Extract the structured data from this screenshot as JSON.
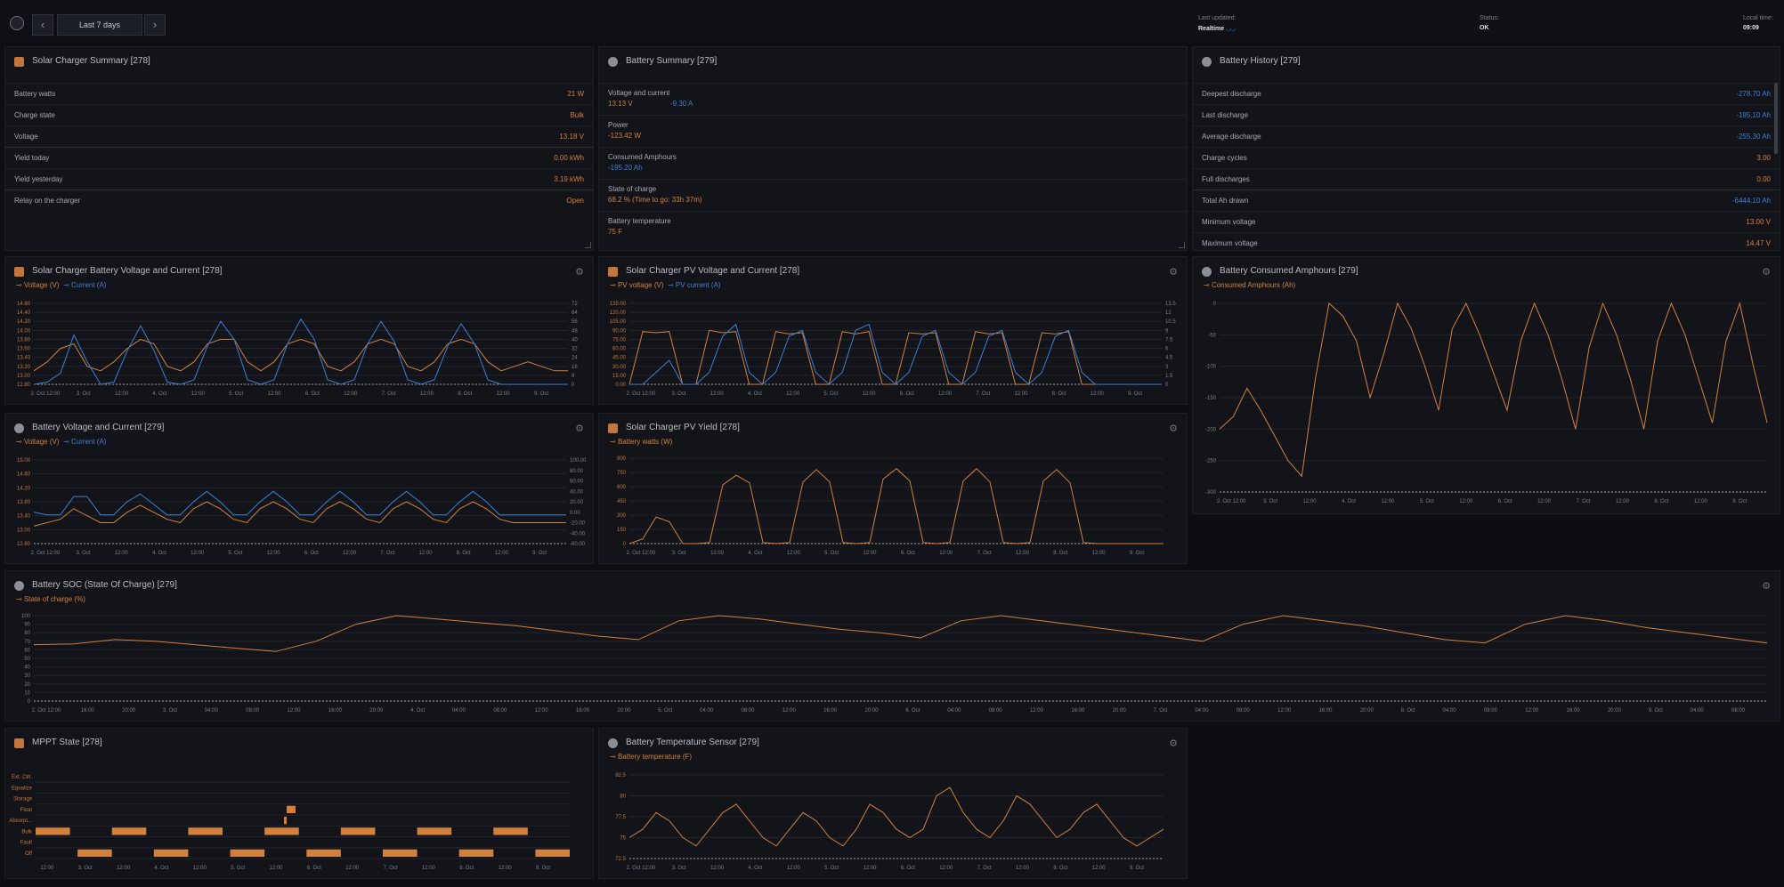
{
  "topbar": {
    "range": "Last 7 days",
    "prev_icon": "chevron-left-icon",
    "next_icon": "chevron-right-icon",
    "last_updated_label": "Last updated:",
    "last_updated_value": "Realtime",
    "status_label": "Status:",
    "status_value": "OK",
    "local_time_label": "Local time:",
    "local_time_value": "09:09"
  },
  "solar_summary": {
    "title": "Solar Charger Summary [278]",
    "rows": [
      {
        "label": "Battery watts",
        "value": "21 W"
      },
      {
        "label": "Charge state",
        "value": "Bulk"
      },
      {
        "label": "Voltage",
        "value": "13.18 V"
      },
      {
        "label": "Yield today",
        "value": "0.00 kWh"
      },
      {
        "label": "Yield yesterday",
        "value": "3.19 kWh"
      },
      {
        "label": "Relay on the charger",
        "value": "Open"
      }
    ]
  },
  "battery_summary": {
    "title": "Battery Summary [279]",
    "voltage_current_label": "Voltage and current",
    "voltage": "13.13 V",
    "current": "-9.30 A",
    "power_label": "Power",
    "power": "-123.42 W",
    "consumed_label": "Consumed Amphours",
    "consumed": "-195.20 Ah",
    "soc_label": "State of charge",
    "soc": "68.2 % (Time to go: 33h 37m)",
    "temp_label": "Battery temperature",
    "temp": "75 F"
  },
  "battery_history": {
    "title": "Battery History [279]",
    "rows": [
      {
        "label": "Deepest discharge",
        "value": "-278.70 Ah",
        "blue": true
      },
      {
        "label": "Last discharge",
        "value": "-195.10 Ah",
        "blue": true
      },
      {
        "label": "Average discharge",
        "value": "-255.30 Ah",
        "blue": true
      },
      {
        "label": "Charge cycles",
        "value": "3.00",
        "blue": false
      },
      {
        "label": "Full discharges",
        "value": "0.00",
        "blue": false
      },
      {
        "label": "Total Ah drawn",
        "value": "-6444.10 Ah",
        "blue": true
      },
      {
        "label": "Minimum voltage",
        "value": "13.00 V",
        "blue": false
      },
      {
        "label": "Maximum voltage",
        "value": "14.47 V",
        "blue": false
      }
    ]
  },
  "charts": {
    "sc_bvc": {
      "title": "Solar Charger Battery Voltage and Current [278]",
      "legend": [
        "Voltage (V)",
        "Current (A)"
      ],
      "gear": "gear-icon"
    },
    "sc_pvc": {
      "title": "Solar Charger PV Voltage and Current [278]",
      "legend": [
        "PV voltage (V)",
        "PV current (A)"
      ],
      "gear": "gear-icon"
    },
    "bca": {
      "title": "Battery Consumed Amphours [279]",
      "legend": [
        "Consumed Amphours (Ah)"
      ],
      "gear": "gear-icon"
    },
    "bvc": {
      "title": "Battery Voltage and Current [279]",
      "legend": [
        "Voltage (V)",
        "Current (A)"
      ],
      "gear": "gear-icon"
    },
    "pvy": {
      "title": "Solar Charger PV Yield [278]",
      "legend": [
        "Battery watts (W)"
      ],
      "gear": "gear-icon"
    },
    "soc": {
      "title": "Battery SOC (State Of Charge) [279]",
      "legend": [
        "State of charge (%)"
      ],
      "gear": "gear-icon"
    },
    "mppt": {
      "title": "MPPT State [278]"
    },
    "temp": {
      "title": "Battery Temperature Sensor [279]",
      "legend": [
        "Battery temperature (F)"
      ],
      "gear": "gear-icon"
    }
  },
  "chart_data": [
    {
      "id": "sc_bvc",
      "type": "line",
      "x_ticks": [
        "2. Oct 12:00",
        "3. Oct",
        "12:00",
        "4. Oct",
        "12:00",
        "5. Oct",
        "12:00",
        "6. Oct",
        "12:00",
        "7. Oct",
        "12:00",
        "8. Oct",
        "12:00",
        "9. Oct"
      ],
      "y_left_ticks": [
        "14.60",
        "14.40",
        "14.20",
        "14.00",
        "13.80",
        "13.60",
        "13.40",
        "13.20",
        "13.00",
        "12.80"
      ],
      "y_right_ticks": [
        "72",
        "64",
        "56",
        "48",
        "40",
        "32",
        "24",
        "16",
        "8",
        "0"
      ],
      "series": [
        {
          "name": "Voltage (V)",
          "color": "#d2803e",
          "values": [
            13.1,
            13.3,
            13.6,
            13.7,
            13.2,
            13.1,
            13.3,
            13.6,
            13.8,
            13.7,
            13.2,
            13.1,
            13.3,
            13.7,
            13.8,
            13.8,
            13.3,
            13.1,
            13.3,
            13.7,
            13.8,
            13.7,
            13.2,
            13.1,
            13.3,
            13.7,
            13.8,
            13.7,
            13.2,
            13.1,
            13.3,
            13.7,
            13.8,
            13.7,
            13.3,
            13.1,
            13.2,
            13.3,
            13.2,
            13.1,
            13.1
          ]
        },
        {
          "name": "Current (A)",
          "color": "#3d7fd6",
          "values": [
            0,
            2,
            10,
            44,
            20,
            0,
            2,
            30,
            52,
            30,
            2,
            0,
            4,
            34,
            56,
            40,
            4,
            0,
            4,
            36,
            58,
            40,
            4,
            0,
            4,
            36,
            56,
            38,
            4,
            0,
            4,
            34,
            54,
            36,
            4,
            0,
            0,
            0,
            0,
            0,
            0
          ]
        }
      ]
    },
    {
      "id": "sc_pvc",
      "type": "line",
      "x_ticks": [
        "2. Oct 12:00",
        "3. Oct",
        "12:00",
        "4. Oct",
        "12:00",
        "5. Oct",
        "12:00",
        "6. Oct",
        "12:00",
        "7. Oct",
        "12:00",
        "8. Oct",
        "12:00",
        "9. Oct"
      ],
      "y_left_ticks": [
        "135.00",
        "120.00",
        "105.00",
        "90.00",
        "75.00",
        "60.00",
        "45.00",
        "30.00",
        "15.00",
        "0.00"
      ],
      "y_right_ticks": [
        "13.5",
        "12",
        "10.5",
        "9",
        "7.5",
        "6",
        "4.5",
        "3",
        "1.5",
        "0"
      ],
      "series": [
        {
          "name": "PV voltage (V)",
          "color": "#d2803e",
          "values": [
            0,
            88,
            86,
            88,
            0,
            0,
            90,
            86,
            88,
            0,
            0,
            88,
            84,
            86,
            0,
            0,
            88,
            84,
            88,
            0,
            0,
            86,
            84,
            86,
            0,
            0,
            88,
            84,
            86,
            0,
            0,
            86,
            84,
            88,
            0,
            0,
            0,
            0,
            0,
            0,
            0
          ]
        },
        {
          "name": "PV current (A)",
          "color": "#3d7fd6",
          "values": [
            0,
            0,
            2,
            4,
            0,
            0,
            2,
            8,
            10,
            2,
            0,
            2,
            8,
            9,
            2,
            0,
            2,
            9,
            10,
            2,
            0,
            2,
            8,
            9,
            2,
            0,
            2,
            8,
            9,
            2,
            0,
            2,
            8,
            9,
            2,
            0,
            0,
            0,
            0,
            0,
            0
          ]
        }
      ]
    },
    {
      "id": "bca",
      "type": "line",
      "x_ticks": [
        "2. Oct 12:00",
        "3. Oct",
        "12:00",
        "4. Oct",
        "12:00",
        "5. Oct",
        "12:00",
        "6. Oct",
        "12:00",
        "7. Oct",
        "12:00",
        "8. Oct",
        "12:00",
        "9. Oct"
      ],
      "y_ticks": [
        "0",
        "-50",
        "-100",
        "-150",
        "-200",
        "-250",
        "-300"
      ],
      "series": [
        {
          "name": "Consumed Amphours (Ah)",
          "color": "#d2803e",
          "values": [
            -200,
            -180,
            -135,
            -170,
            -210,
            -250,
            -275,
            -120,
            0,
            -20,
            -60,
            -150,
            -80,
            0,
            -40,
            -100,
            -170,
            -40,
            0,
            -50,
            -110,
            -170,
            -60,
            0,
            -50,
            -120,
            -200,
            -70,
            0,
            -50,
            -120,
            -200,
            -60,
            0,
            -50,
            -120,
            -190,
            -60,
            0,
            -100,
            -190
          ]
        }
      ]
    },
    {
      "id": "bvc",
      "type": "line",
      "x_ticks": [
        "2. Oct 12:00",
        "3. Oct",
        "12:00",
        "4. Oct",
        "12:00",
        "5. Oct",
        "12:00",
        "6. Oct",
        "12:00",
        "7. Oct",
        "12:00",
        "8. Oct",
        "12:00",
        "9. Oct"
      ],
      "y_left_ticks": [
        "15.00",
        "14.60",
        "14.20",
        "13.80",
        "13.40",
        "13.00",
        "12.60"
      ],
      "y_right_ticks": [
        "100.00",
        "80.00",
        "60.00",
        "40.00",
        "20.00",
        "0.00",
        "-20.00",
        "-40.00",
        "-60.00"
      ],
      "series": [
        {
          "name": "Voltage (V)",
          "color": "#d2803e",
          "values": [
            13.1,
            13.2,
            13.3,
            13.6,
            13.4,
            13.2,
            13.2,
            13.5,
            13.7,
            13.5,
            13.3,
            13.2,
            13.6,
            13.8,
            13.6,
            13.3,
            13.2,
            13.6,
            13.8,
            13.6,
            13.3,
            13.2,
            13.6,
            13.8,
            13.6,
            13.3,
            13.2,
            13.6,
            13.8,
            13.6,
            13.3,
            13.2,
            13.6,
            13.8,
            13.6,
            13.3,
            13.2,
            13.2,
            13.2,
            13.2,
            13.2
          ]
        },
        {
          "name": "Current (A)",
          "color": "#3d7fd6",
          "values": [
            0,
            -5,
            -5,
            30,
            30,
            -5,
            -5,
            20,
            35,
            15,
            -5,
            -5,
            20,
            40,
            20,
            -5,
            -5,
            20,
            40,
            20,
            -5,
            -5,
            20,
            40,
            20,
            -5,
            -5,
            20,
            40,
            20,
            -5,
            -5,
            20,
            40,
            20,
            -5,
            -5,
            -5,
            -5,
            -5,
            -5
          ]
        }
      ]
    },
    {
      "id": "pvy",
      "type": "line",
      "x_ticks": [
        "2. Oct 12:00",
        "3. Oct",
        "12:00",
        "4. Oct",
        "12:00",
        "5. Oct",
        "12:00",
        "6. Oct",
        "12:00",
        "7. Oct",
        "12:00",
        "8. Oct",
        "12:00",
        "9. Oct"
      ],
      "y_ticks": [
        "900",
        "750",
        "600",
        "450",
        "300",
        "150",
        "0"
      ],
      "series": [
        {
          "name": "Battery watts (W)",
          "color": "#d2803e",
          "values": [
            0,
            50,
            280,
            230,
            0,
            0,
            10,
            620,
            720,
            640,
            10,
            0,
            10,
            650,
            780,
            650,
            10,
            0,
            10,
            680,
            790,
            660,
            10,
            0,
            10,
            660,
            790,
            650,
            10,
            0,
            10,
            660,
            780,
            640,
            10,
            0,
            0,
            0,
            0,
            0,
            0
          ]
        }
      ]
    },
    {
      "id": "soc",
      "type": "line",
      "x_ticks": [
        "2. Oct 12:00",
        "16:00",
        "20:00",
        "3. Oct",
        "04:00",
        "08:00",
        "12:00",
        "16:00",
        "20:00",
        "4. Oct",
        "04:00",
        "08:00",
        "12:00",
        "16:00",
        "20:00",
        "5. Oct",
        "04:00",
        "08:00",
        "12:00",
        "16:00",
        "20:00",
        "6. Oct",
        "04:00",
        "08:00",
        "12:00",
        "16:00",
        "20:00",
        "7. Oct",
        "04:00",
        "08:00",
        "12:00",
        "16:00",
        "20:00",
        "8. Oct",
        "04:00",
        "08:00",
        "12:00",
        "16:00",
        "20:00",
        "9. Oct",
        "04:00",
        "08:00"
      ],
      "y_ticks": [
        "100",
        "90",
        "80",
        "70",
        "60",
        "50",
        "40",
        "30",
        "20",
        "10",
        "0"
      ],
      "series": [
        {
          "name": "State of charge (%)",
          "color": "#d2803e",
          "values": [
            66,
            67,
            72,
            70,
            66,
            62,
            58,
            70,
            90,
            100,
            96,
            92,
            88,
            82,
            76,
            72,
            94,
            100,
            96,
            90,
            84,
            80,
            74,
            94,
            100,
            94,
            88,
            82,
            76,
            70,
            90,
            100,
            94,
            88,
            80,
            72,
            68,
            90,
            100,
            94,
            86,
            80,
            74,
            68
          ]
        }
      ]
    },
    {
      "id": "mppt",
      "type": "state",
      "x_ticks": [
        "12:00",
        "3. Oct",
        "12:00",
        "4. Oct",
        "12:00",
        "5. Oct",
        "12:00",
        "6. Oct",
        "12:00",
        "7. Oct",
        "12:00",
        "8. Oct",
        "12:00",
        "9. Oct"
      ],
      "states": [
        "Ext. Ctrl.",
        "Equalize",
        "Storage",
        "Float",
        "Absorpt...",
        "Bulk",
        "Fault",
        "Off"
      ]
    },
    {
      "id": "temp",
      "type": "line",
      "x_ticks": [
        "2. Oct 12:00",
        "3. Oct",
        "12:00",
        "4. Oct",
        "12:00",
        "5. Oct",
        "12:00",
        "6. Oct",
        "12:00",
        "7. Oct",
        "12:00",
        "8. Oct",
        "12:00",
        "9. Oct"
      ],
      "y_ticks": [
        "82.5",
        "80",
        "77.5",
        "75",
        "72.5"
      ],
      "series": [
        {
          "name": "Battery temperature (F)",
          "color": "#d2803e",
          "values": [
            75,
            76,
            78,
            77,
            75,
            74,
            76,
            78,
            79,
            77,
            75,
            74,
            76,
            78,
            77,
            75,
            74,
            76,
            79,
            78,
            76,
            75,
            76,
            80,
            81,
            78,
            76,
            75,
            77,
            80,
            79,
            77,
            75,
            76,
            78,
            79,
            77,
            75,
            74,
            75,
            76
          ]
        }
      ]
    }
  ]
}
